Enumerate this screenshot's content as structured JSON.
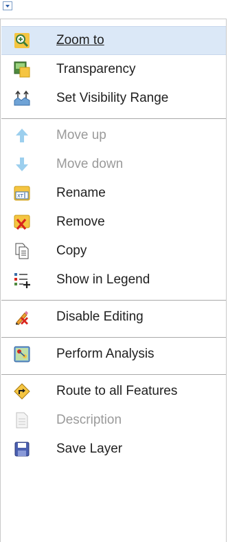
{
  "menu": {
    "items": [
      {
        "label": "Zoom to",
        "icon": "zoom-in-icon",
        "disabled": false,
        "hover": true
      },
      {
        "label": "Transparency",
        "icon": "transparency-icon",
        "disabled": false
      },
      {
        "label": "Set Visibility Range",
        "icon": "visibility-range-icon",
        "disabled": false
      },
      {
        "label": "Move up",
        "icon": "arrow-up-icon",
        "disabled": true
      },
      {
        "label": "Move down",
        "icon": "arrow-down-icon",
        "disabled": true
      },
      {
        "label": "Rename",
        "icon": "rename-icon",
        "disabled": false
      },
      {
        "label": "Remove",
        "icon": "remove-icon",
        "disabled": false
      },
      {
        "label": "Copy",
        "icon": "copy-icon",
        "disabled": false
      },
      {
        "label": "Show in Legend",
        "icon": "legend-icon",
        "disabled": false
      },
      {
        "label": "Disable Editing",
        "icon": "disable-editing-icon",
        "disabled": false
      },
      {
        "label": "Perform Analysis",
        "icon": "analysis-icon",
        "disabled": false
      },
      {
        "label": "Route to all Features",
        "icon": "route-icon",
        "disabled": false
      },
      {
        "label": "Description",
        "icon": "description-icon",
        "disabled": true
      },
      {
        "label": "Save Layer",
        "icon": "save-icon",
        "disabled": false
      }
    ]
  }
}
